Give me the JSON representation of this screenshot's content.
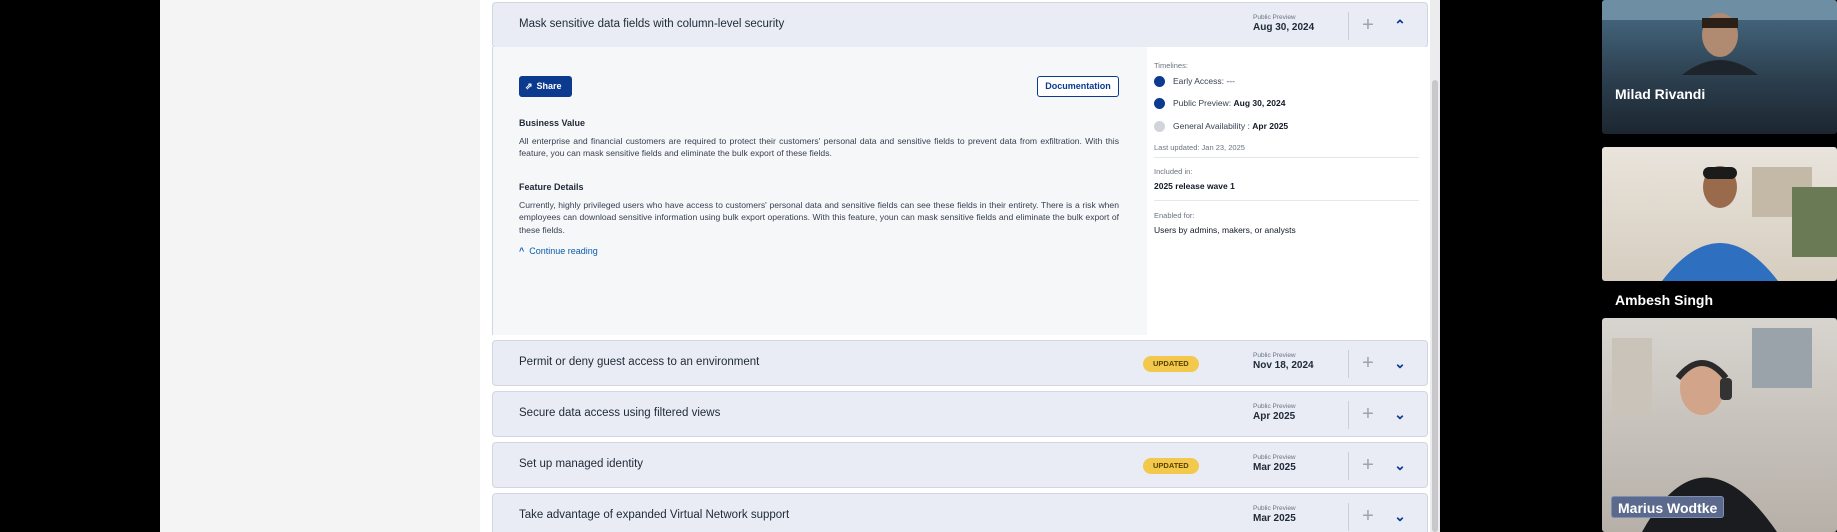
{
  "expanded_item": {
    "title": "Mask sensitive data fields with column-level security",
    "date_caption": "Public Preview",
    "date": "Aug 30, 2024",
    "share_label": "Share",
    "documentation_label": "Documentation",
    "business_value_heading": "Business Value",
    "business_value_text": "All enterprise and financial customers are required to protect their customers' personal data and sensitive fields to prevent data from exfiltration. With this feature, you can mask sensitive fields and eliminate the bulk export of these fields.",
    "feature_details_heading": "Feature Details",
    "feature_details_text": "Currently, highly privileged users who have access to customers' personal data and sensitive fields can see these fields in their entirety. There is a risk when employees can download sensitive information using bulk export operations. With this feature, youn can mask sensitive fields and eliminate the bulk export of these fields.",
    "continue_label": "Continue reading",
    "timelines_label": "Timelines:",
    "timeline": [
      {
        "label": "Early Access:",
        "value": "---",
        "color": "#0b3a8f"
      },
      {
        "label": "Public Preview:",
        "value": "Aug 30, 2024",
        "color": "#0b3a8f"
      },
      {
        "label": "General Availability :",
        "value": "Apr 2025",
        "color": "#d1d5db"
      }
    ],
    "last_updated": "Last updated: Jan 23, 2025",
    "included_in_label": "Included in:",
    "included_in_value": "2025 release wave 1",
    "enabled_for_label": "Enabled for:",
    "enabled_for_value": "Users by admins, makers, or analysts"
  },
  "collapsed_items": [
    {
      "title": "Permit or deny guest access to an environment",
      "badge": "UPDATED",
      "date_caption": "Public Preview",
      "date": "Nov 18, 2024"
    },
    {
      "title": "Secure data access using filtered views",
      "badge": "",
      "date_caption": "Public Preview",
      "date": "Apr 2025"
    },
    {
      "title": "Set up managed identity",
      "badge": "UPDATED",
      "date_caption": "Public Preview",
      "date": "Mar 2025"
    },
    {
      "title": "Take advantage of expanded Virtual Network support",
      "badge": "",
      "date_caption": "Public Preview",
      "date": "Mar 2025"
    }
  ],
  "participants": [
    {
      "name": "Milad Rivandi"
    },
    {
      "name": "Ambesh Singh"
    },
    {
      "name": "Marius Wodtke"
    }
  ],
  "colors": {
    "accent": "#0b3a8f",
    "badge": "#f2c94c",
    "row_bg": "#e9ecf4"
  }
}
